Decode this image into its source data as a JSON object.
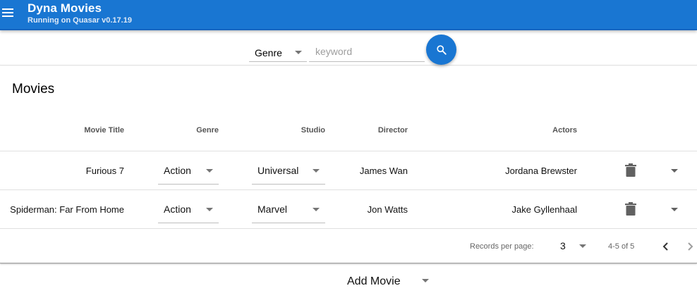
{
  "header": {
    "title": "Dyna Movies",
    "subtitle": "Running on Quasar v0.17.19",
    "brand_color": "#1976d2"
  },
  "search": {
    "genre_value": "Genre",
    "keyword_placeholder": "keyword",
    "search_icon": "search-icon"
  },
  "table": {
    "title": "Movies",
    "columns": [
      "Movie Title",
      "Genre",
      "Studio",
      "Director",
      "Actors"
    ],
    "rows": [
      {
        "title": "Furious 7",
        "genre": "Action",
        "studio": "Universal",
        "director": "James Wan",
        "actors": "Jordana Brewster"
      },
      {
        "title": "Spiderman: Far From Home",
        "genre": "Action",
        "studio": "Marvel",
        "director": "Jon Watts",
        "actors": "Jake Gyllenhaal"
      }
    ],
    "pagination": {
      "rows_per_page_label": "Records per page:",
      "rows_per_page": "3",
      "range": "4-5 of 5"
    }
  },
  "add_movie": {
    "label": "Add Movie"
  }
}
